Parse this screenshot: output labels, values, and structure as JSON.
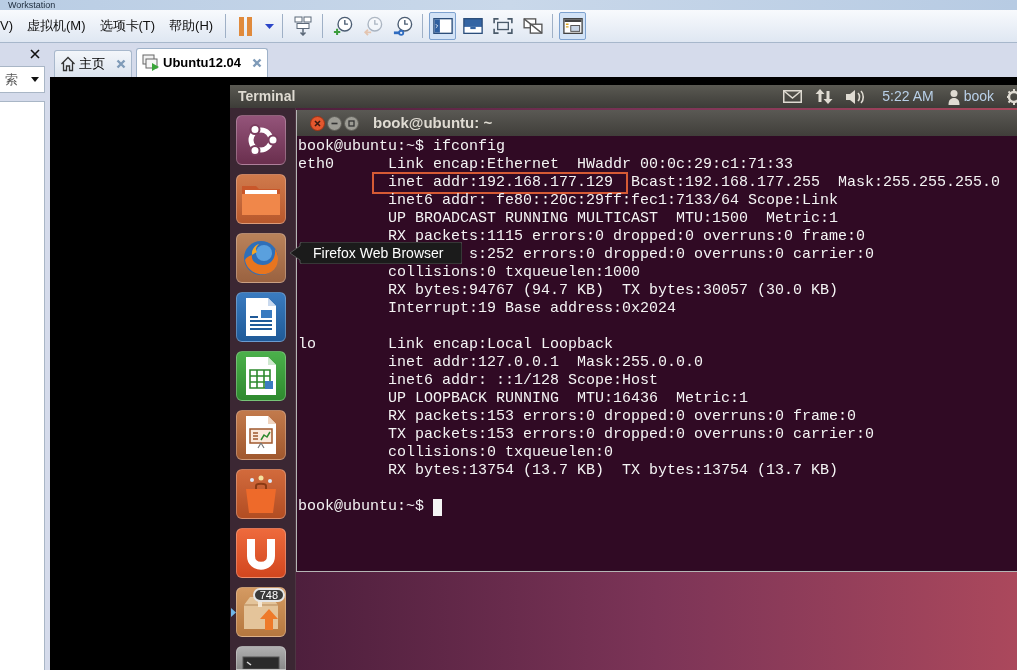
{
  "window": {
    "title": "Workstation"
  },
  "menu": [
    {
      "label": "V)"
    },
    {
      "label": "虚拟机(M)"
    },
    {
      "label": "选项卡(T)"
    },
    {
      "label": "帮助(H)"
    }
  ],
  "toolbar": {
    "groups": [
      [
        {
          "kind": "pause",
          "selected": false,
          "disabled": false
        },
        {
          "kind": "caret",
          "selected": false,
          "disabled": false
        }
      ],
      [
        {
          "kind": "send_keys",
          "selected": false,
          "disabled": false
        }
      ],
      [
        {
          "kind": "snapshot_take",
          "selected": false,
          "disabled": false
        },
        {
          "kind": "snapshot_revert",
          "selected": false,
          "disabled": true
        },
        {
          "kind": "snapshot_manager",
          "selected": false,
          "disabled": false
        }
      ],
      [
        {
          "kind": "view_console",
          "selected": true,
          "disabled": false
        },
        {
          "kind": "view_fullscreen",
          "selected": false,
          "disabled": false
        },
        {
          "kind": "view_fit",
          "selected": false,
          "disabled": false
        },
        {
          "kind": "view_unity",
          "selected": false,
          "disabled": false
        }
      ],
      [
        {
          "kind": "thumbnails",
          "selected": true,
          "disabled": false
        }
      ]
    ]
  },
  "library": {
    "search": {
      "placeholder": "索"
    }
  },
  "tabs": [
    {
      "kind": "home",
      "label": "主页",
      "selected": false
    },
    {
      "kind": "vm",
      "label": "Ubuntu12.04",
      "selected": true
    }
  ],
  "guest": {
    "top_panel": {
      "app_title": "Terminal",
      "clock": "5:22 AM",
      "user": "book"
    },
    "launcher": {
      "items": [
        {
          "kind": "dash",
          "running": false
        },
        {
          "kind": "files",
          "running": false
        },
        {
          "kind": "browser",
          "running": false,
          "tooltip": "Firefox Web Browser"
        },
        {
          "kind": "writer",
          "running": false
        },
        {
          "kind": "calc",
          "running": false
        },
        {
          "kind": "impress",
          "running": false
        },
        {
          "kind": "software",
          "running": false
        },
        {
          "kind": "cloud",
          "running": false
        },
        {
          "kind": "updates",
          "running": true,
          "badge": "748"
        },
        {
          "kind": "terminal",
          "running": false
        }
      ]
    },
    "terminal": {
      "title": "book@ubuntu: ~",
      "lines": [
        {
          "kind": "prompt",
          "text": "book@ubuntu:~$ ifconfig",
          "cursor": false
        },
        {
          "kind": "output",
          "label": "eth0",
          "segments": [
            {
              "text": "Link encap:Ethernet  HWaddr 00:0c:29:c1:71:33",
              "highlighted": false
            }
          ]
        },
        {
          "kind": "output",
          "segments": [
            {
              "text": "inet addr:192.168.177.129",
              "highlighted": true
            },
            {
              "text": "Bcast:192.168.177.255  Mask:255.255.255.0",
              "highlighted": false
            }
          ]
        },
        {
          "kind": "output",
          "segments": [
            {
              "text": "inet6 addr: fe80::20c:29ff:fec1:7133/64 Scope:Link",
              "highlighted": false
            }
          ]
        },
        {
          "kind": "output",
          "segments": [
            {
              "text": "UP BROADCAST RUNNING MULTICAST  MTU:1500  Metric:1",
              "highlighted": false
            }
          ]
        },
        {
          "kind": "output",
          "segments": [
            {
              "text": "RX packets:1115 errors:0 dropped:0 overruns:0 frame:0",
              "highlighted": false
            }
          ]
        },
        {
          "kind": "partial",
          "segments": [
            {
              "text": "s:252 errors:0 dropped:0 overruns:0 carrier:0",
              "highlighted": false
            }
          ]
        },
        {
          "kind": "output",
          "segments": [
            {
              "text": "collisions:0 txqueuelen:1000",
              "highlighted": false
            }
          ]
        },
        {
          "kind": "output",
          "segments": [
            {
              "text": "RX bytes:94767 (94.7 KB)  TX bytes:30057 (30.0 KB)",
              "highlighted": false
            }
          ]
        },
        {
          "kind": "output",
          "segments": [
            {
              "text": "Interrupt:19 Base address:0x2024",
              "highlighted": false
            }
          ]
        },
        {
          "kind": "blank"
        },
        {
          "kind": "output",
          "label": "lo",
          "segments": [
            {
              "text": "Link encap:Local Loopback",
              "highlighted": false
            }
          ]
        },
        {
          "kind": "output",
          "segments": [
            {
              "text": "inet addr:127.0.0.1  Mask:255.0.0.0",
              "highlighted": false
            }
          ]
        },
        {
          "kind": "output",
          "segments": [
            {
              "text": "inet6 addr: ::1/128 Scope:Host",
              "highlighted": false
            }
          ]
        },
        {
          "kind": "output",
          "segments": [
            {
              "text": "UP LOOPBACK RUNNING  MTU:16436  Metric:1",
              "highlighted": false
            }
          ]
        },
        {
          "kind": "output",
          "segments": [
            {
              "text": "RX packets:153 errors:0 dropped:0 overruns:0 frame:0",
              "highlighted": false
            }
          ]
        },
        {
          "kind": "output",
          "segments": [
            {
              "text": "TX packets:153 errors:0 dropped:0 overruns:0 carrier:0",
              "highlighted": false
            }
          ]
        },
        {
          "kind": "output",
          "segments": [
            {
              "text": "collisions:0 txqueuelen:0",
              "highlighted": false
            }
          ]
        },
        {
          "kind": "output",
          "segments": [
            {
              "text": "RX bytes:13754 (13.7 KB)  TX bytes:13754 (13.7 KB)",
              "highlighted": false
            }
          ]
        },
        {
          "kind": "blank"
        },
        {
          "kind": "prompt",
          "text": "book@ubuntu:~$",
          "cursor": true
        }
      ]
    }
  }
}
